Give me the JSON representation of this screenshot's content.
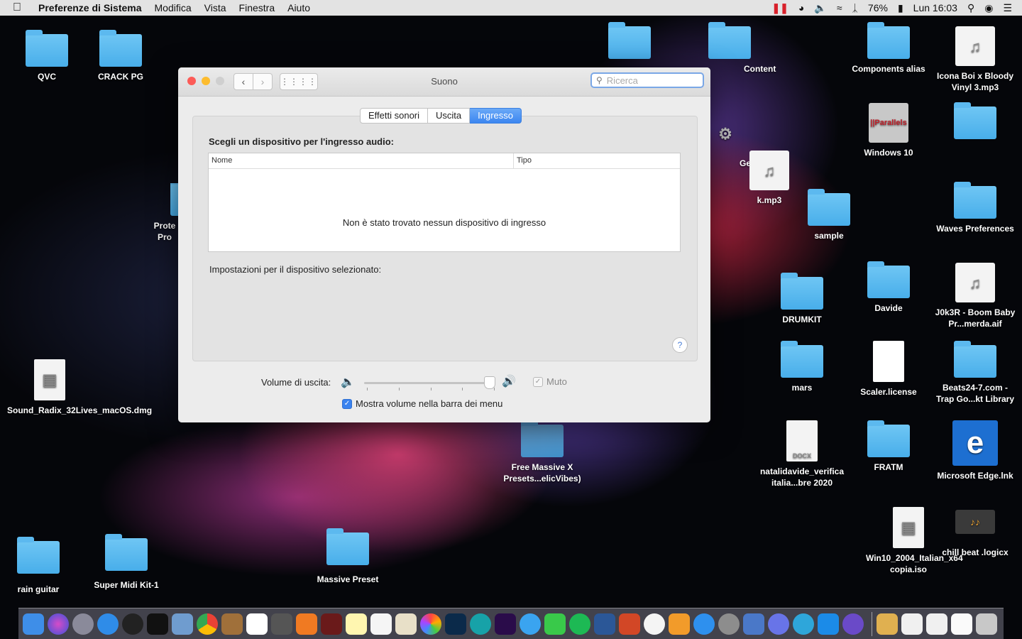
{
  "menubar": {
    "apple": "",
    "app_name": "Preferenze di Sistema",
    "items": [
      "Modifica",
      "Vista",
      "Finestra",
      "Aiuto"
    ],
    "battery": "76%",
    "clock": "Lun 16:03"
  },
  "window": {
    "title": "Suono",
    "search_placeholder": "Ricerca",
    "tabs": [
      "Effetti sonori",
      "Uscita",
      "Ingresso"
    ],
    "active_tab": "Ingresso",
    "section_label": "Scegli un dispositivo per l'ingresso audio:",
    "table": {
      "columns": [
        "Nome",
        "Tipo"
      ],
      "empty_message": "Non è stato trovato nessun dispositivo di ingresso"
    },
    "settings_label": "Impostazioni per il dispositivo selezionato:",
    "help": "?",
    "volume_label": "Volume di uscita:",
    "volume_level": 0.95,
    "mute_label": "Muto",
    "mute_checked": true,
    "show_volume_label": "Mostra volume nella barra dei menu",
    "show_volume_checked": true
  },
  "desktop": {
    "icons": [
      {
        "label": "QVC",
        "type": "folder"
      },
      {
        "label": "CRACK PG",
        "type": "folder"
      },
      {
        "label": "Content",
        "type": "folder"
      },
      {
        "label": "Components alias",
        "type": "folder"
      },
      {
        "label": "Icona Boi x Bloody Vinyl 3.mp3",
        "type": "audio"
      },
      {
        "label": "Windows 10",
        "type": "app"
      },
      {
        "label": "Gen.exe",
        "type": "file"
      },
      {
        "label": "k.mp3",
        "type": "audio"
      },
      {
        "label": "sample",
        "type": "folder"
      },
      {
        "label": "Waves Preferences",
        "type": "folder"
      },
      {
        "label": "Prote Pro",
        "type": "folder"
      },
      {
        "label": "DRUMKIT",
        "type": "folder"
      },
      {
        "label": "Davide",
        "type": "folder"
      },
      {
        "label": "J0k3R - Boom Baby Pr...merda.aif",
        "type": "audio"
      },
      {
        "label": "Sound_Radix_32Lives_macOS.dmg",
        "type": "disk"
      },
      {
        "label": "mars",
        "type": "folder"
      },
      {
        "label": "Scaler.license",
        "type": "file"
      },
      {
        "label": "Beats24-7.com - Trap Go...kt Library",
        "type": "folder"
      },
      {
        "label": "Free Massive X Presets...elicVibes)",
        "type": "folder"
      },
      {
        "label": "natalidavide_verifica italia...bre 2020",
        "type": "docx"
      },
      {
        "label": "FRATM",
        "type": "folder"
      },
      {
        "label": "Microsoft Edge.lnk",
        "type": "app"
      },
      {
        "label": "Win10_2004_Italian_x64 copia.iso",
        "type": "disk"
      },
      {
        "label": "chill beat .logicx",
        "type": "file"
      },
      {
        "label": "rain guitar",
        "type": "folder"
      },
      {
        "label": "Super Midi Kit-1",
        "type": "folder"
      },
      {
        "label": "Massive Preset",
        "type": "folder"
      }
    ]
  },
  "colors": {
    "accent": "#3c86f0",
    "close": "#fc5b57",
    "minimize": "#fdbc2e",
    "folder": "#48aeea"
  }
}
